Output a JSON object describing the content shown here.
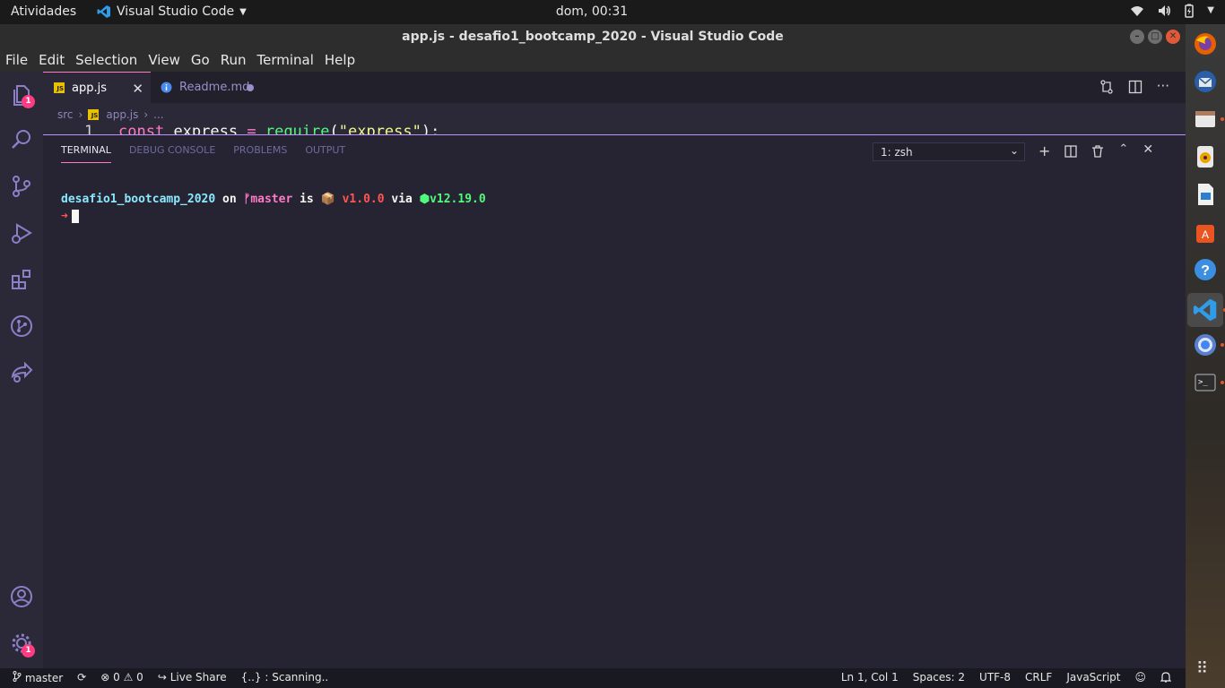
{
  "topbar": {
    "activities": "Atividades",
    "app_name": "Visual Studio Code",
    "clock": "dom, 00:31"
  },
  "window": {
    "title": "app.js - desafio1_bootcamp_2020 - Visual Studio Code"
  },
  "menu": [
    "File",
    "Edit",
    "Selection",
    "View",
    "Go",
    "Run",
    "Terminal",
    "Help"
  ],
  "activity_badges": {
    "explorer": "1",
    "settings": "1"
  },
  "tabs": [
    {
      "label": "app.js",
      "icon": "JS",
      "active": true
    },
    {
      "label": "Readme.md",
      "icon": "info-icon",
      "active": false
    }
  ],
  "breadcrumb": {
    "folder": "src",
    "file": "app.js",
    "rest": "..."
  },
  "editor": {
    "line_number": "1",
    "tokens": [
      "const",
      "express",
      "=",
      "require",
      "(",
      "\"express\"",
      ");"
    ]
  },
  "panel": {
    "tabs": [
      "TERMINAL",
      "DEBUG CONSOLE",
      "PROBLEMS",
      "OUTPUT"
    ],
    "active_tab": "TERMINAL",
    "terminal_select": "1: zsh"
  },
  "terminal": {
    "dir": "desafio1_bootcamp_2020",
    "on": "on",
    "branch_glyph": "ᚠ",
    "branch": "master",
    "is": "is",
    "pkg_glyph": "📦",
    "version": "v1.0.0",
    "via": "via",
    "node_glyph": "⬢",
    "node_version": "v12.19.0",
    "prompt": "➜"
  },
  "status": {
    "branch": "master",
    "errors": "0",
    "warnings": "0",
    "live_share": "Live Share",
    "scanning": "{..} : Scanning..",
    "position": "Ln 1, Col 1",
    "spaces": "Spaces: 2",
    "encoding": "UTF-8",
    "eol": "CRLF",
    "language": "JavaScript"
  },
  "colors": {
    "accent": "#ff79c6",
    "activity_bar": "#2b2838",
    "panel_bg": "#262433"
  }
}
